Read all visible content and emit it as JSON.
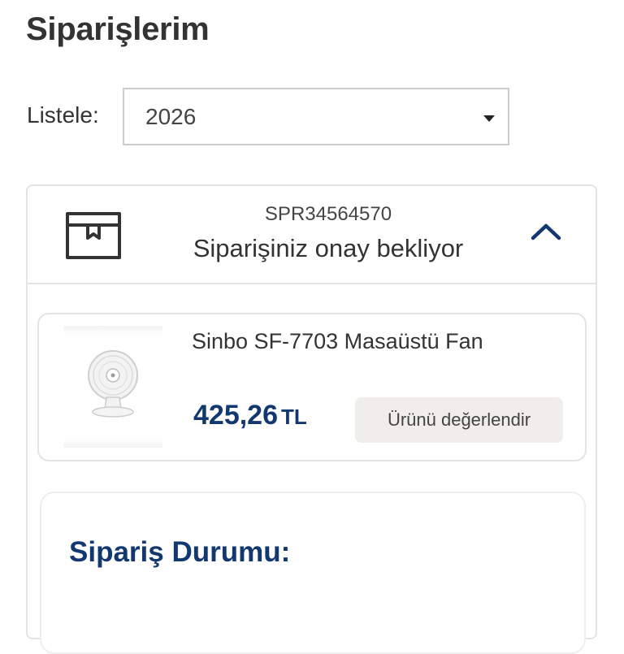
{
  "page": {
    "title": "Siparişlerim"
  },
  "filter": {
    "label": "Listele:",
    "selected_year": "2026"
  },
  "order": {
    "number": "SPR34564570",
    "status": "Siparişiniz onay bekliyor",
    "icons": {
      "box": "package-box-icon",
      "toggle": "chevron-up-icon"
    },
    "item": {
      "name": "Sinbo SF-7703 Masaüstü Fan",
      "price": "425,26",
      "currency": "TL",
      "rate_button": "Ürünü değerlendir",
      "image": "desk-fan-image"
    },
    "status_section": {
      "title": "Sipariş Durumu:"
    }
  },
  "colors": {
    "accent": "#13386f",
    "text": "#333333",
    "border": "#e4e4e4",
    "button_bg": "#f0eeea"
  }
}
